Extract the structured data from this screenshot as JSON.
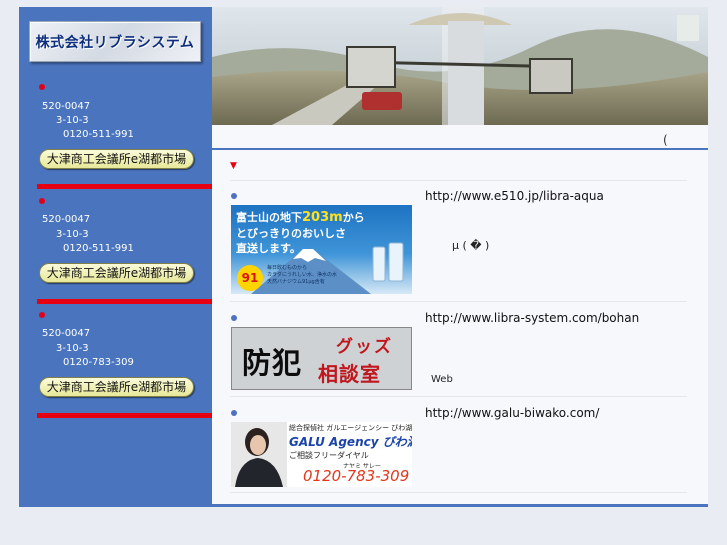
{
  "logo": {
    "text": "株式会社リブラシステム"
  },
  "sidebar": {
    "blocks": [
      {
        "postal": "520-0047",
        "address": "3-10-3",
        "phone": "0120-511-991",
        "button": "大津商工会議所e湖都市場"
      },
      {
        "postal": "520-0047",
        "address": "3-10-3",
        "phone": "0120-511-991",
        "button": "大津商工会議所e湖都市場"
      },
      {
        "postal": "520-0047",
        "address": "3-10-3",
        "phone": "0120-783-309",
        "button": "大津商工会議所e湖都市場"
      }
    ]
  },
  "header": {
    "paren": "("
  },
  "marker": "▼",
  "entries": [
    {
      "url": "http://www.e510.jp/libra-aqua",
      "note": "µ ( � )",
      "thumb": {
        "line1a": "富士山の地下",
        "line1b": "203m",
        "line1c": "から",
        "line2": "とびっきりのおいしさ",
        "line3": "直送します。",
        "badge": "91",
        "small1": "毎日飲むものから",
        "small2": "カラダにうれしい水、浄水の水",
        "small3": "天然バナジウム91μg含有"
      }
    },
    {
      "url": "http://www.libra-system.com/bohan",
      "note": "Web",
      "thumb": {
        "big": "防犯",
        "top": "グッズ",
        "bottom": "相談室"
      }
    },
    {
      "url": "http://www.galu-biwako.com/",
      "thumb": {
        "line1": "総合探偵社 ガルエージェンシー びわ湖",
        "brand": "GALU Agency",
        "brand2": "びわ湖",
        "line3": "ご相談フリーダイヤル",
        "reading": "ナヤミ    サレー",
        "phone": "0120-783-309"
      }
    }
  ],
  "colors": {
    "sidebar": "#4a74bd",
    "separator": "#e60012",
    "accent_blue": "#4a74bd"
  }
}
